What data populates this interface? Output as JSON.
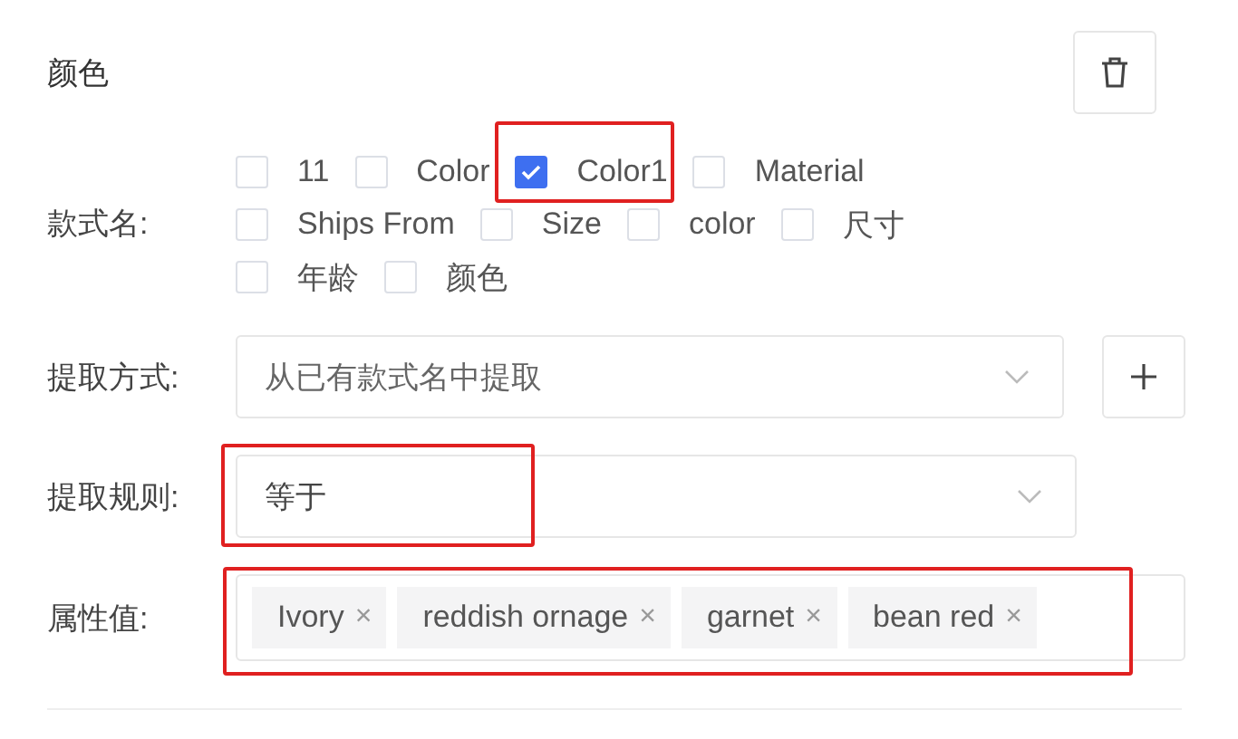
{
  "title": "颜色",
  "style_names": {
    "label": "款式名:",
    "options": [
      {
        "label": "11",
        "checked": false,
        "highlighted": false
      },
      {
        "label": "Color",
        "checked": false,
        "highlighted": false
      },
      {
        "label": "Color1",
        "checked": true,
        "highlighted": true
      },
      {
        "label": "Material",
        "checked": false,
        "highlighted": false
      },
      {
        "label": "Ships From",
        "checked": false,
        "highlighted": false
      },
      {
        "label": "Size",
        "checked": false,
        "highlighted": false
      },
      {
        "label": "color",
        "checked": false,
        "highlighted": false
      },
      {
        "label": "尺寸",
        "checked": false,
        "highlighted": false
      },
      {
        "label": "年龄",
        "checked": false,
        "highlighted": false
      },
      {
        "label": "颜色",
        "checked": false,
        "highlighted": false
      }
    ]
  },
  "method": {
    "label": "提取方式:",
    "value": "从已有款式名中提取"
  },
  "rule": {
    "label": "提取规则:",
    "value": "等于",
    "highlighted": true
  },
  "values": {
    "label": "属性值:",
    "highlighted": true,
    "tags": [
      {
        "label": "Ivory",
        "close": "×"
      },
      {
        "label": "reddish ornage",
        "close": "×"
      },
      {
        "label": "garnet",
        "close": "×"
      },
      {
        "label": "bean red",
        "close": "×"
      }
    ]
  }
}
